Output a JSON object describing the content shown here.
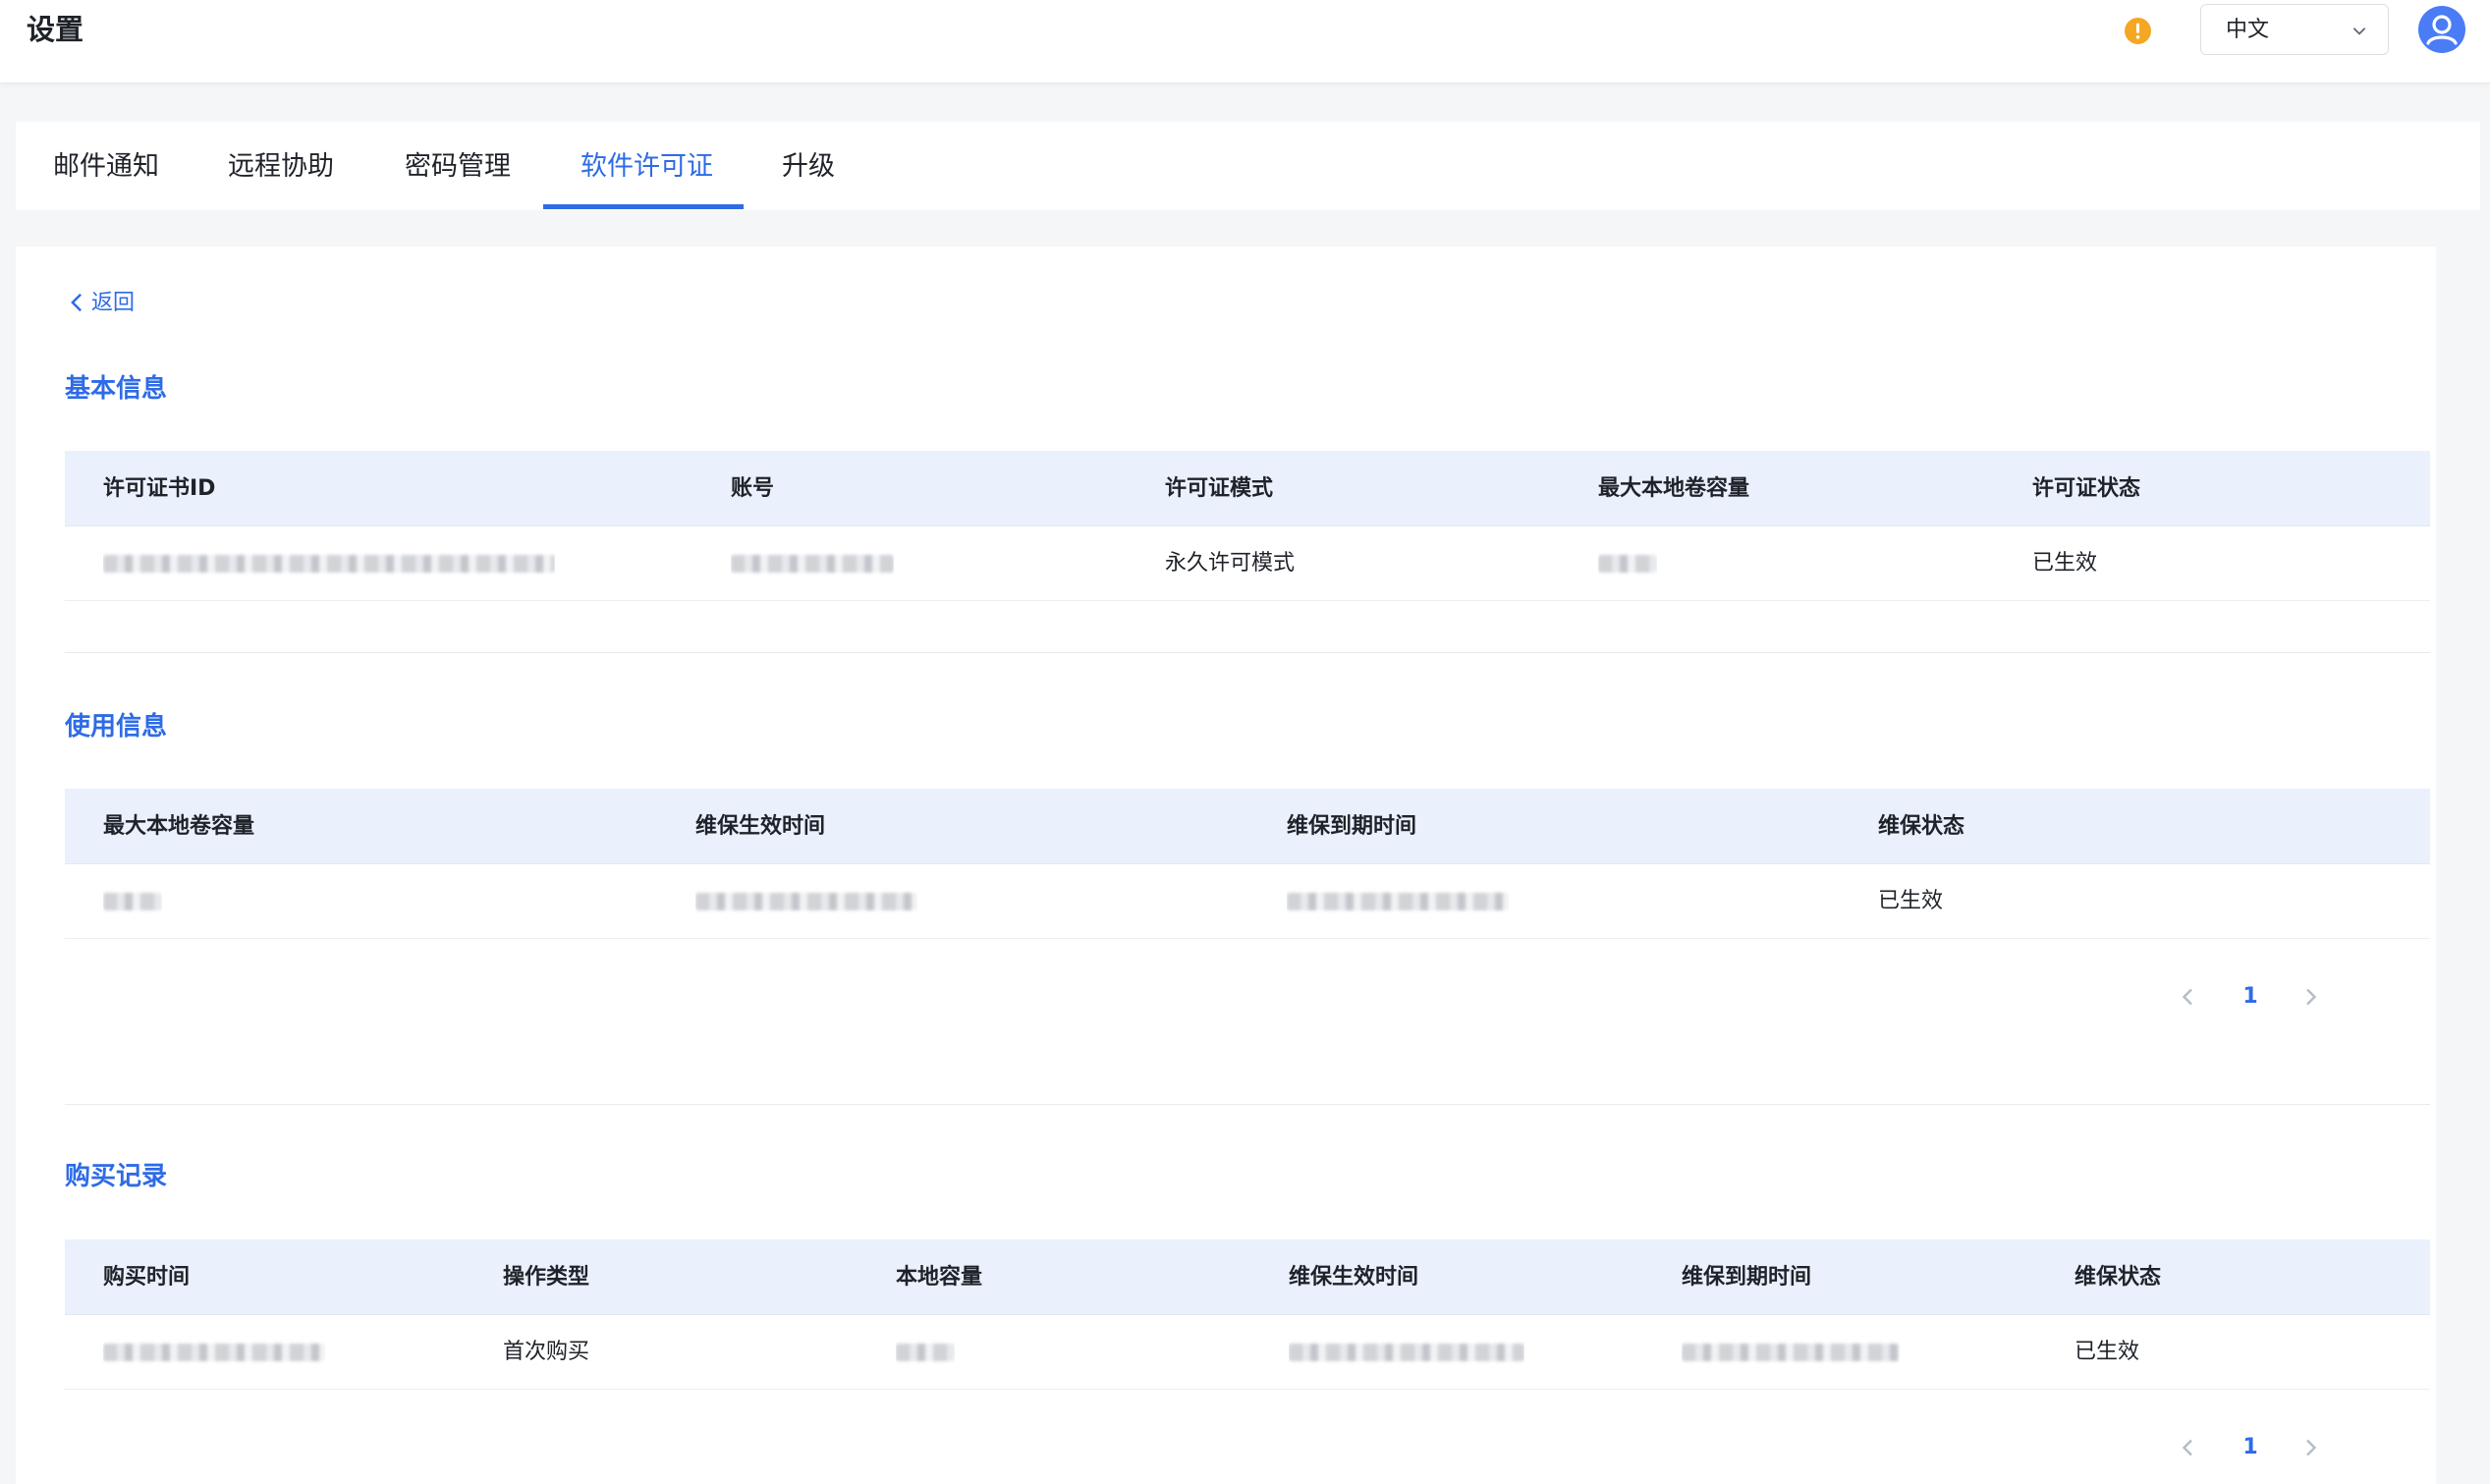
{
  "header": {
    "title": "设置",
    "alert_icon": "warning-icon",
    "language": "中文",
    "accent_color": "#2e6be6",
    "alert_color": "#f5a623"
  },
  "tabs": [
    {
      "label": "邮件通知"
    },
    {
      "label": "远程协助"
    },
    {
      "label": "密码管理"
    },
    {
      "label": "软件许可证",
      "active": true
    },
    {
      "label": "升级"
    }
  ],
  "back_label": "返回",
  "basic_info": {
    "title": "基本信息",
    "columns": [
      "许可证书ID",
      "账号",
      "许可证模式",
      "最大本地卷容量",
      "许可证状态"
    ],
    "rows": [
      {
        "license_mode": "永久许可模式",
        "status": "已生效"
      }
    ]
  },
  "usage_info": {
    "title": "使用信息",
    "columns": [
      "最大本地卷容量",
      "维保生效时间",
      "维保到期时间",
      "维保状态"
    ],
    "rows": [
      {
        "status": "已生效"
      }
    ],
    "pagination": {
      "current_page": "1"
    }
  },
  "purchase_records": {
    "title": "购买记录",
    "columns": [
      "购买时间",
      "操作类型",
      "本地容量",
      "维保生效时间",
      "维保到期时间",
      "维保状态"
    ],
    "rows": [
      {
        "operation": "首次购买",
        "status": "已生效"
      }
    ],
    "pagination": {
      "current_page": "1"
    }
  }
}
